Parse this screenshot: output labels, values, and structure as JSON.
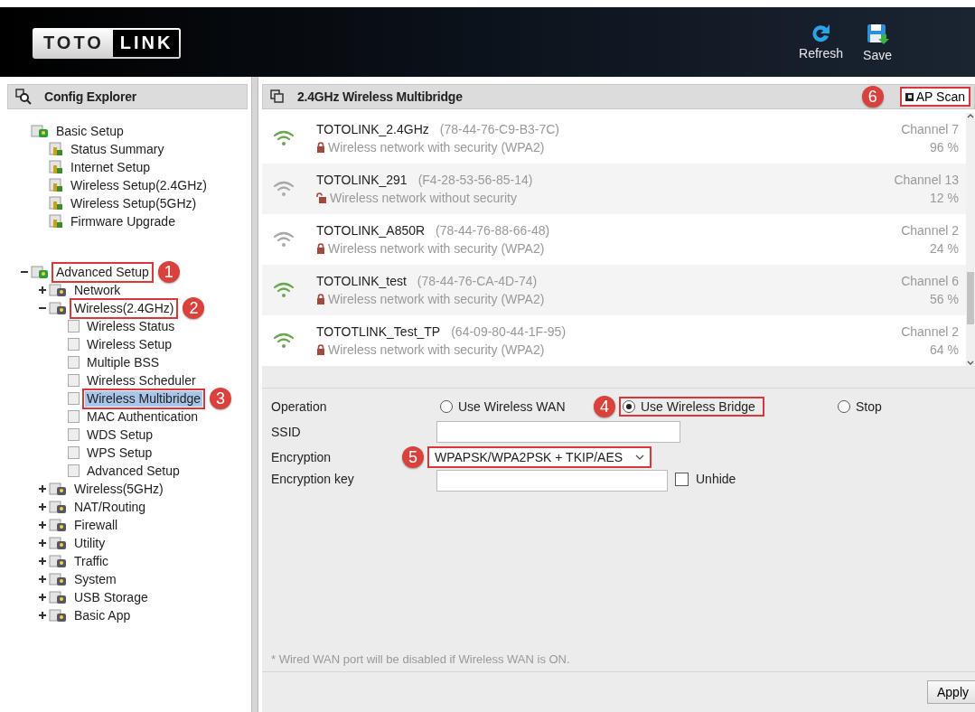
{
  "header": {
    "logo": [
      "TOTO",
      "LINK"
    ],
    "buttons": [
      {
        "kind": "refresh",
        "label": "Refresh"
      },
      {
        "kind": "save",
        "label": "Save"
      }
    ]
  },
  "sidebar": {
    "title": "Config Explorer",
    "tree": [
      {
        "label": "Basic Setup",
        "selected": false,
        "children": [
          {
            "label": "Status Summary",
            "selected": false
          },
          {
            "label": "Internet Setup",
            "selected": false
          },
          {
            "label": "Wireless Setup(2.4GHz)",
            "selected": false
          },
          {
            "label": "Wireless Setup(5GHz)",
            "selected": false
          },
          {
            "label": "Firmware Upgrade",
            "selected": false
          }
        ]
      },
      {
        "label": "Advanced Setup",
        "selected": false,
        "expanded": true,
        "callout": "1",
        "children": [
          {
            "label": "Network",
            "selected": false,
            "expanded": false
          },
          {
            "label": "Wireless(2.4GHz)",
            "selected": false,
            "expanded": true,
            "callout": "2",
            "children": [
              {
                "label": "Wireless Status",
                "selected": false
              },
              {
                "label": "Wireless Setup",
                "selected": false
              },
              {
                "label": "Multiple BSS",
                "selected": false
              },
              {
                "label": "Wireless Scheduler",
                "selected": false
              },
              {
                "label": "Wireless Multibridge",
                "selected": true,
                "callout": "3"
              },
              {
                "label": "MAC Authentication",
                "selected": false
              },
              {
                "label": "WDS Setup",
                "selected": false
              },
              {
                "label": "WPS Setup",
                "selected": false
              },
              {
                "label": "Advanced Setup",
                "selected": false
              }
            ]
          },
          {
            "label": "Wireless(5GHz)",
            "selected": false,
            "expanded": false
          },
          {
            "label": "NAT/Routing",
            "selected": false,
            "expanded": false
          },
          {
            "label": "Firewall",
            "selected": false,
            "expanded": false
          },
          {
            "label": "Utility",
            "selected": false,
            "expanded": false
          },
          {
            "label": "Traffic",
            "selected": false,
            "expanded": false
          },
          {
            "label": "System",
            "selected": false,
            "expanded": false
          },
          {
            "label": "USB Storage",
            "selected": false,
            "expanded": false
          },
          {
            "label": "Basic App",
            "selected": false,
            "expanded": false
          }
        ]
      }
    ]
  },
  "main": {
    "title": "2.4GHz Wireless Multibridge",
    "ap_scan": {
      "label": "AP Scan",
      "callout": "6"
    },
    "networks": [
      {
        "ssid": "TOTOLINK_2.4GHz",
        "mac": "(78-44-76-C9-B3-7C)",
        "security": "Wireless network with security (WPA2)",
        "secured": true,
        "channel": "Channel 7",
        "signal": "96 %",
        "color": "#6aa84f"
      },
      {
        "ssid": "TOTOLINK_291",
        "mac": "(F4-28-53-56-85-14)",
        "security": "Wireless network without security",
        "secured": false,
        "channel": "Channel 13",
        "signal": "12 %",
        "color": "#a9a9a9"
      },
      {
        "ssid": "TOTOLINK_A850R",
        "mac": "(78-44-76-88-66-48)",
        "security": "Wireless network with security (WPA2)",
        "secured": true,
        "channel": "Channel 2",
        "signal": "24 %",
        "color": "#a9a9a9"
      },
      {
        "ssid": "TOTOLINK_test",
        "mac": "(78-44-76-CA-4D-74)",
        "security": "Wireless network with security (WPA2)",
        "secured": true,
        "channel": "Channel 6",
        "signal": "56 %",
        "color": "#6aa84f"
      },
      {
        "ssid": "TOTOTLINK_Test_TP",
        "mac": "(64-09-80-44-1F-95)",
        "security": "Wireless network with security (WPA2)",
        "secured": true,
        "channel": "Channel 2",
        "signal": "64 %",
        "color": "#6aa84f"
      }
    ],
    "form": {
      "operation": {
        "label": "Operation",
        "options": [
          {
            "label": "Use Wireless WAN",
            "selected": false
          },
          {
            "label": "Use Wireless Bridge",
            "selected": true,
            "callout": "4"
          },
          {
            "label": "Stop",
            "selected": false
          }
        ]
      },
      "ssid": {
        "label": "SSID"
      },
      "encryption": {
        "label": "Encryption",
        "value": "WPAPSK/WPA2PSK + TKIP/AES",
        "callout": "5"
      },
      "encryption_key": {
        "label": "Encryption key"
      },
      "unhide": {
        "label": "Unhide",
        "checked": false
      }
    },
    "note": "* Wired WAN port will be disabled if Wireless WAN is ON.",
    "apply": "Apply"
  }
}
